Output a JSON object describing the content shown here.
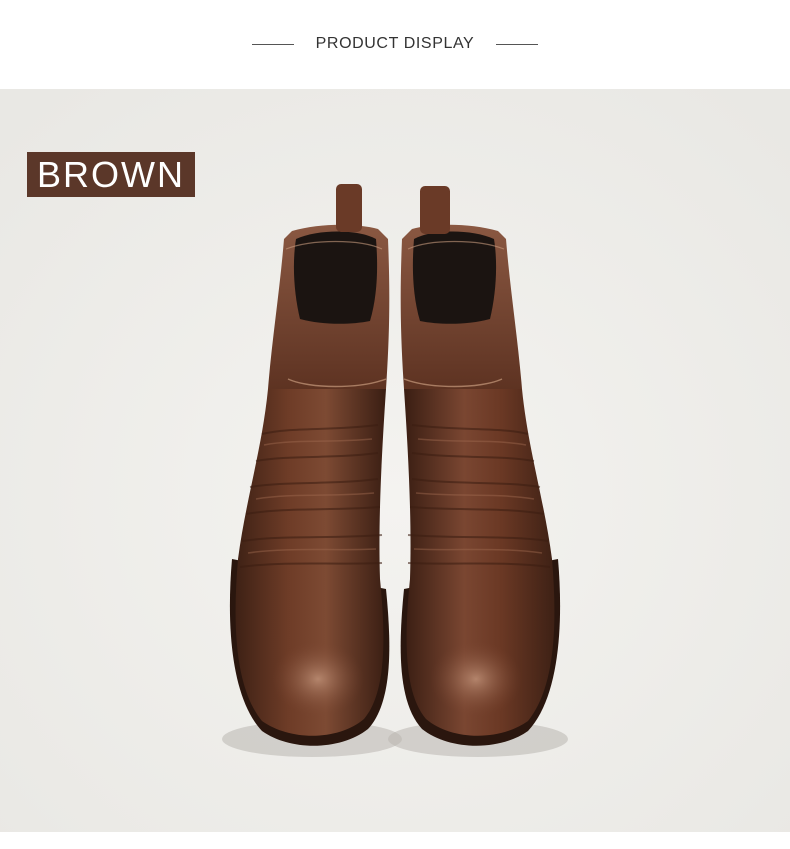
{
  "header": {
    "title": "PRODUCT DISPLAY"
  },
  "badge": {
    "label": "BROWN"
  },
  "colors": {
    "badge_background": "#5b3729",
    "photo_background": "#efeeeb",
    "leather": "#6b3a26"
  }
}
